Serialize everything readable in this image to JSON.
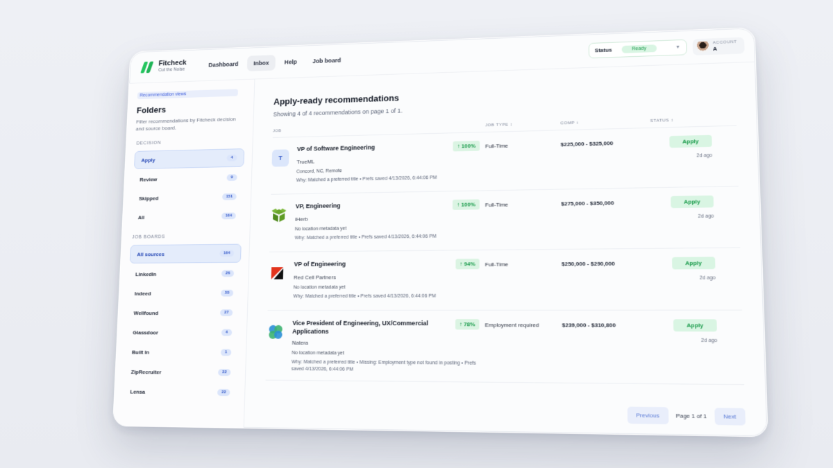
{
  "app": {
    "name": "Fitcheck",
    "tagline": "Cut the Noise"
  },
  "nav": [
    {
      "label": "Dashboard",
      "active": false
    },
    {
      "label": "Inbox",
      "active": true
    },
    {
      "label": "Help",
      "active": false
    },
    {
      "label": "Job board",
      "active": false
    }
  ],
  "status": {
    "label": "Status",
    "value": "Ready"
  },
  "account": {
    "label": "ACCOUNT",
    "name": "A"
  },
  "sidebar": {
    "views_label": "Recommendation views",
    "title": "Folders",
    "subtitle": "Filter recommendations by Fitcheck decision and source board.",
    "decision_label": "DECISION",
    "decisions": [
      {
        "label": "Apply",
        "count": "4",
        "active": true
      },
      {
        "label": "Review",
        "count": "9",
        "active": false
      },
      {
        "label": "Skipped",
        "count": "151",
        "active": false
      },
      {
        "label": "All",
        "count": "164",
        "active": false
      }
    ],
    "boards_label": "JOB BOARDS",
    "boards": [
      {
        "label": "All sources",
        "count": "164",
        "active": true
      },
      {
        "label": "LinkedIn",
        "count": "26",
        "active": false
      },
      {
        "label": "Indeed",
        "count": "55",
        "active": false
      },
      {
        "label": "Wellfound",
        "count": "27",
        "active": false
      },
      {
        "label": "Glassdoor",
        "count": "4",
        "active": false
      },
      {
        "label": "Built In",
        "count": "1",
        "active": false
      },
      {
        "label": "ZipRecruiter",
        "count": "22",
        "active": false
      },
      {
        "label": "Lensa",
        "count": "22",
        "active": false
      }
    ]
  },
  "main": {
    "title": "Apply-ready recommendations",
    "subtitle": "Showing 4 of 4 recommendations on page 1 of 1.",
    "columns": {
      "job": "JOB",
      "job_type": "JOB TYPE ↕",
      "comp": "COMP ↕",
      "status": "STATUS ↕"
    },
    "rows": [
      {
        "logo": "T",
        "logo_icon": "letter-t-logo",
        "title": "VP of Software Engineering",
        "match": "↑ 100%",
        "company": "TrueML",
        "location": "Concord, NC, Remote",
        "why": "Why: Matched a preferred title • Prefs saved 4/13/2026, 6:44:06 PM",
        "job_type": "Full-Time",
        "comp": "$225,000 - $325,000",
        "action": "Apply",
        "ago": "2d ago"
      },
      {
        "logo_icon": "green-box-logo",
        "title": "VP, Engineering",
        "match": "↑ 100%",
        "company": "iHerb",
        "location": "No location metadata yet",
        "why": "Why: Matched a preferred title • Prefs saved 4/13/2026, 6:44:06 PM",
        "job_type": "Full-Time",
        "comp": "$275,000 - $350,000",
        "action": "Apply",
        "ago": "2d ago"
      },
      {
        "logo_icon": "red-black-triangle-logo",
        "title": "VP of Engineering",
        "match": "↑ 94%",
        "company": "Red Cell Partners",
        "location": "No location metadata yet",
        "why": "Why: Matched a preferred title • Prefs saved 4/13/2026, 6:44:06 PM",
        "job_type": "Full-Time",
        "comp": "$250,000 - $290,000",
        "action": "Apply",
        "ago": "2d ago"
      },
      {
        "logo_icon": "blue-green-circles-logo",
        "title": "Vice President of Engineering, UX/Commercial Applications",
        "match": "↑ 78%",
        "company": "Natera",
        "location": "No location metadata yet",
        "why": "Why: Matched a preferred title • Missing: Employment type not found in posting • Prefs saved 4/13/2026, 6:44:06 PM",
        "job_type": "Employment required",
        "comp": "$239,000 - $310,800",
        "action": "Apply",
        "ago": "2d ago"
      }
    ]
  },
  "pager": {
    "previous": "Previous",
    "info": "Page 1 of 1",
    "next": "Next"
  },
  "colors": {
    "accent_green": "#23c55e",
    "accent_blue": "#2f55c8"
  }
}
